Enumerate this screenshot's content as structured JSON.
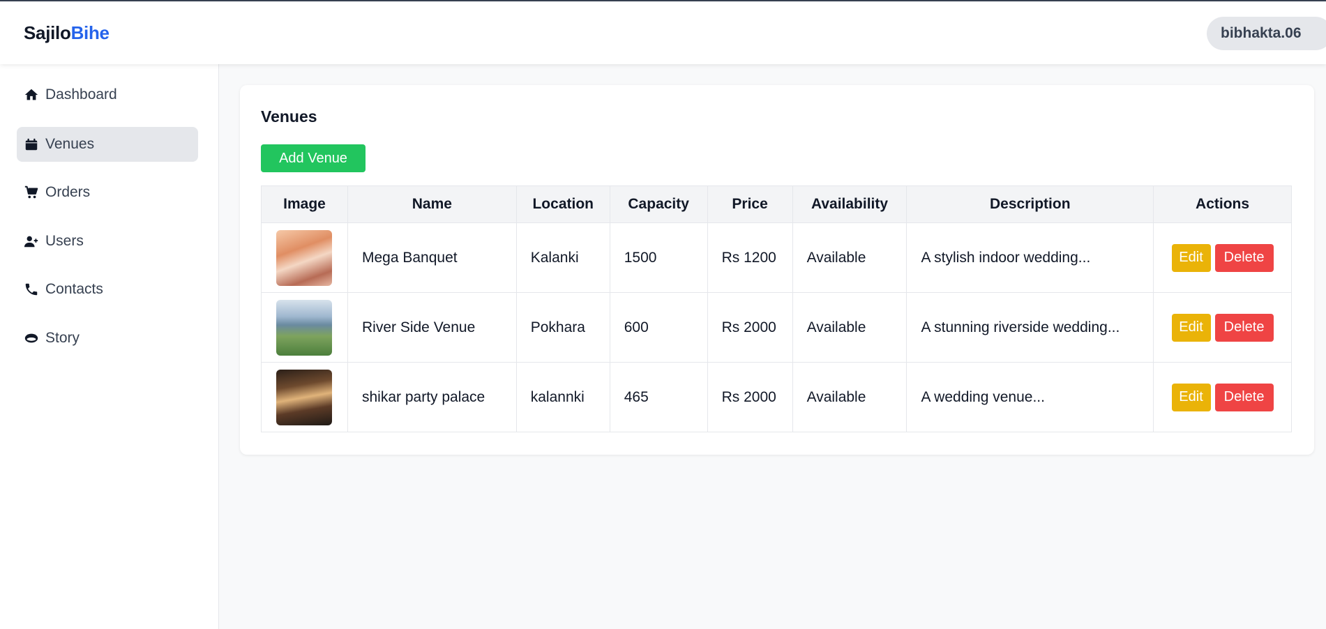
{
  "header": {
    "brand_part1": "Sajilo",
    "brand_part2": "Bihe",
    "username": "bibhakta.06"
  },
  "sidebar": {
    "items": [
      {
        "label": "Dashboard",
        "icon": "home-icon"
      },
      {
        "label": "Venues",
        "icon": "calendar-icon",
        "active": true
      },
      {
        "label": "Orders",
        "icon": "cart-icon"
      },
      {
        "label": "Users",
        "icon": "user-plus-icon"
      },
      {
        "label": "Contacts",
        "icon": "phone-icon"
      },
      {
        "label": "Story",
        "icon": "story-icon"
      }
    ]
  },
  "main": {
    "title": "Venues",
    "add_button": "Add Venue",
    "table": {
      "headers": [
        "Image",
        "Name",
        "Location",
        "Capacity",
        "Price",
        "Availability",
        "Description",
        "Actions"
      ],
      "rows": [
        {
          "name": "Mega Banquet",
          "location": "Kalanki",
          "capacity": "1500",
          "price": "Rs 1200",
          "availability": "Available",
          "description": "A stylish indoor wedding..."
        },
        {
          "name": "River Side Venue",
          "location": "Pokhara",
          "capacity": "600",
          "price": "Rs 2000",
          "availability": "Available",
          "description": "A stunning riverside wedding..."
        },
        {
          "name": "shikar party palace",
          "location": "kalannki",
          "capacity": "465",
          "price": "Rs 2000",
          "availability": "Available",
          "description": "A wedding venue..."
        }
      ],
      "edit_label": "Edit",
      "delete_label": "Delete"
    }
  },
  "colors": {
    "brand_accent": "#2563eb",
    "add_button": "#22c55e",
    "edit_button": "#eab308",
    "delete_button": "#ef4444"
  }
}
